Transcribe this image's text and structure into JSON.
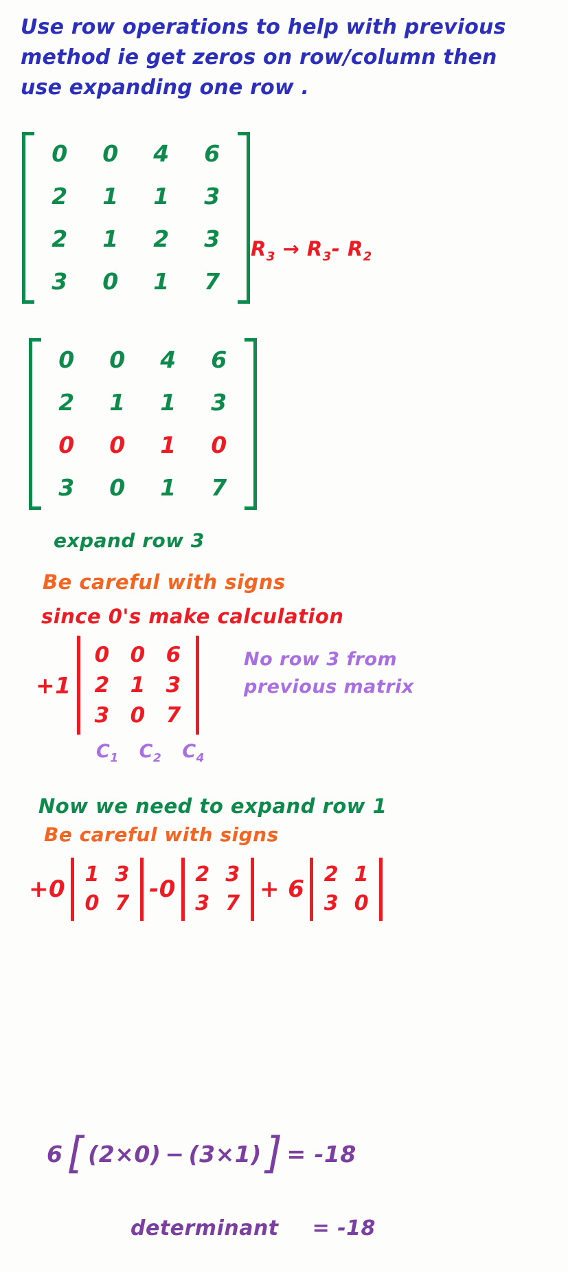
{
  "colors": {
    "blue": "#2b2fba",
    "green": "#0f8a4d",
    "red": "#ec1c24",
    "orange": "#f26522",
    "purple": "#a96fe0",
    "dark_purple": "#7b3fa0"
  },
  "header": {
    "line1": "Use row operations to help with previous",
    "line2": "method ie get zeros on row/column then",
    "line3": "use expanding one row ."
  },
  "matrix_1": {
    "rows": [
      [
        "0",
        "0",
        "4",
        "6"
      ],
      [
        "2",
        "1",
        "1",
        "3"
      ],
      [
        "2",
        "1",
        "2",
        "3"
      ],
      [
        "3",
        "0",
        "1",
        "7"
      ]
    ],
    "highlight_rows": []
  },
  "row_operation": {
    "text": "R₃ → R₃ - R₂",
    "base_left": "R",
    "sub_left": "3",
    "arrow": "→",
    "base_mid": "R",
    "sub_mid": "3",
    "minus": "-",
    "base_right": "R",
    "sub_right": "2"
  },
  "matrix_2": {
    "rows": [
      [
        "0",
        "0",
        "4",
        "6"
      ],
      [
        "2",
        "1",
        "1",
        "3"
      ],
      [
        "0",
        "0",
        "1",
        "0"
      ],
      [
        "3",
        "0",
        "1",
        "7"
      ]
    ],
    "highlight_rows": [
      2
    ]
  },
  "notes": {
    "expand_row_3": "expand row 3",
    "be_careful_1": "Be careful with signs",
    "since_zeros": "since 0's make calculation",
    "expand_row_1": "Now we need to expand row 1",
    "be_careful_2": "Be careful with signs"
  },
  "determinant_3x3": {
    "coefficient": "+1",
    "rows": [
      [
        "0",
        "0",
        "6"
      ],
      [
        "2",
        "1",
        "3"
      ],
      [
        "3",
        "0",
        "7"
      ]
    ],
    "column_labels": [
      {
        "base": "C",
        "sub": "1"
      },
      {
        "base": "C",
        "sub": "2"
      },
      {
        "base": "C",
        "sub": "4"
      }
    ],
    "side_note_line1": "No row 3 from",
    "side_note_line2": "previous matrix"
  },
  "expansion_2x2": {
    "terms": [
      {
        "coefficient": "+0",
        "rows": [
          [
            "1",
            "3"
          ],
          [
            "0",
            "7"
          ]
        ]
      },
      {
        "coefficient": "-0",
        "rows": [
          [
            "2",
            "3"
          ],
          [
            "3",
            "7"
          ]
        ]
      },
      {
        "coefficient": "+ 6",
        "rows": [
          [
            "2",
            "1"
          ],
          [
            "3",
            "0"
          ]
        ]
      }
    ]
  },
  "result": {
    "coefficient": "6",
    "open_bracket": "[",
    "expr_left": "(2×0)",
    "minus": "−",
    "expr_right": "(3×1)",
    "close_bracket": "]",
    "equals": "= -18",
    "determinant_label": "determinant",
    "determinant_value": "= -18"
  }
}
